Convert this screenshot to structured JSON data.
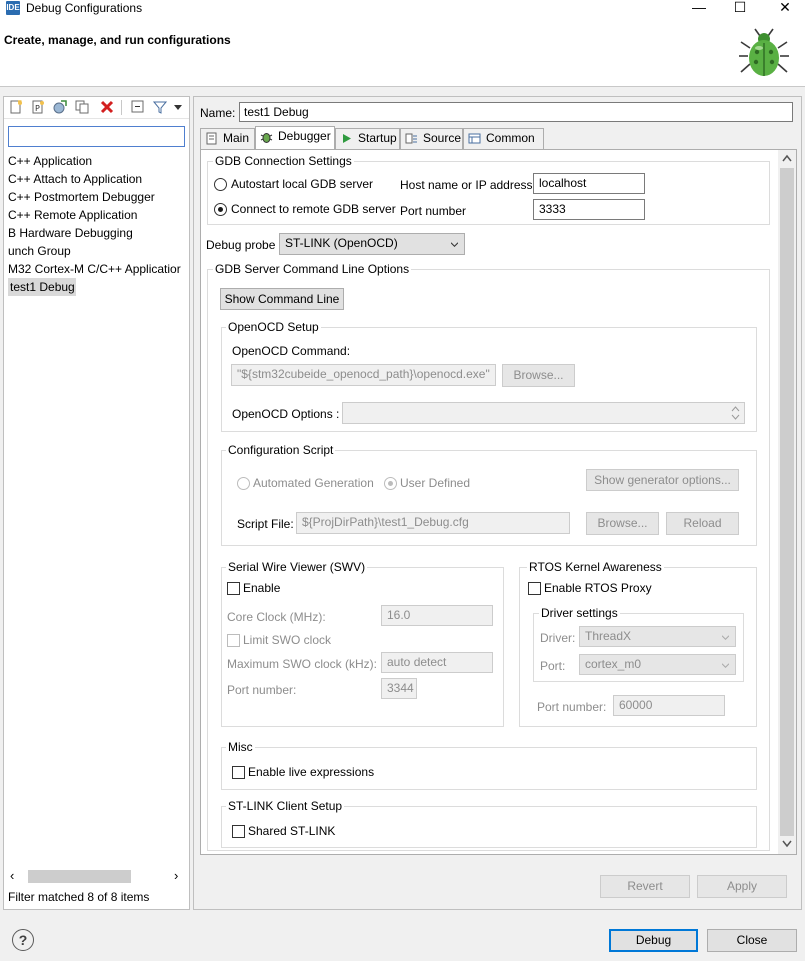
{
  "window": {
    "app_icon_text": "IDE",
    "title": "Debug Configurations",
    "minimize": "—",
    "maximize": "☐",
    "close": "✕"
  },
  "banner": {
    "title": "Create, manage, and run configurations"
  },
  "left": {
    "filter_placeholder": "",
    "tree": [
      "C++ Application",
      "C++ Attach to Application",
      "C++ Postmortem Debugger",
      "C++ Remote Application",
      "B Hardware Debugging",
      "unch Group",
      "M32 Cortex-M C/C++ Applicatior",
      "test1 Debug"
    ],
    "filter_status": "Filter matched 8 of 8 items",
    "scroll_left": "‹",
    "scroll_right": "›"
  },
  "config": {
    "name_label": "Name:",
    "name_value": "test1 Debug",
    "tabs": [
      "Main",
      "Debugger",
      "Startup",
      "Source",
      "Common"
    ]
  },
  "gdb": {
    "group_label": "GDB Connection Settings",
    "autostart_label": "Autostart local GDB server",
    "remote_label": "Connect to remote GDB server",
    "host_label": "Host name or IP address",
    "host_value": "localhost",
    "port_label": "Port number",
    "port_value": "3333"
  },
  "probe": {
    "label": "Debug probe",
    "value": "ST-LINK (OpenOCD)"
  },
  "server_options": {
    "group_label": "GDB Server Command Line Options",
    "show_cmd_button": "Show Command Line"
  },
  "openocd": {
    "group_label": "OpenOCD Setup",
    "command_label": "OpenOCD Command:",
    "command_value": "\"${stm32cubeide_openocd_path}\\openocd.exe\"",
    "browse_button": "Browse...",
    "options_label": "OpenOCD Options :",
    "options_value": ""
  },
  "config_script": {
    "group_label": "Configuration Script",
    "automated_label": "Automated Generation",
    "user_defined_label": "User Defined",
    "show_generator_button": "Show generator options...",
    "script_file_label": "Script File:",
    "script_file_value": "${ProjDirPath}\\test1_Debug.cfg",
    "browse_button": "Browse...",
    "reload_button": "Reload"
  },
  "swv": {
    "group_label": "Serial Wire Viewer (SWV)",
    "enable_label": "Enable",
    "core_clock_label": "Core Clock (MHz):",
    "core_clock_value": "16.0",
    "limit_swo_label": "Limit SWO clock",
    "max_swo_label": "Maximum SWO clock (kHz):",
    "max_swo_value": "auto detect",
    "port_label": "Port number:",
    "port_value": "3344"
  },
  "rtos": {
    "group_label": "RTOS Kernel Awareness",
    "enable_label": "Enable RTOS Proxy",
    "driver_group_label": "Driver settings",
    "driver_label": "Driver:",
    "driver_value": "ThreadX",
    "port_label": "Port:",
    "port_value": "cortex_m0",
    "port_number_label": "Port number:",
    "port_number_value": "60000"
  },
  "misc": {
    "group_label": "Misc",
    "live_expr_label": "Enable live expressions"
  },
  "stlink_client": {
    "group_label": "ST-LINK Client Setup",
    "shared_label": "Shared ST-LINK"
  },
  "actions": {
    "revert": "Revert",
    "apply": "Apply",
    "debug": "Debug",
    "close": "Close"
  },
  "help_icon": "?"
}
